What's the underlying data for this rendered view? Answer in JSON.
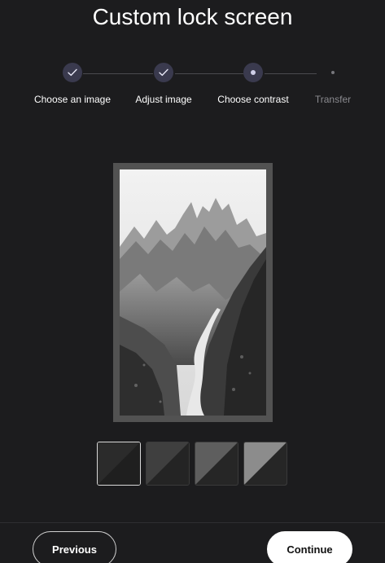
{
  "page": {
    "title": "Custom lock screen"
  },
  "stepper": {
    "steps": [
      {
        "label": "Choose an image",
        "state": "complete"
      },
      {
        "label": "Adjust image",
        "state": "complete"
      },
      {
        "label": "Choose contrast",
        "state": "current"
      },
      {
        "label": "Transfer",
        "state": "upcoming"
      }
    ]
  },
  "preview": {
    "image_description_icon": "mountain-landscape-image"
  },
  "contrast": {
    "options": [
      {
        "id": "contrast-1",
        "selected": true
      },
      {
        "id": "contrast-2",
        "selected": false
      },
      {
        "id": "contrast-3",
        "selected": false
      },
      {
        "id": "contrast-4",
        "selected": false
      }
    ]
  },
  "footer": {
    "previous_label": "Previous",
    "continue_label": "Continue"
  },
  "colors": {
    "background": "#1c1c1e",
    "step_circle": "#3a3a4e",
    "accent_light": "#ffffff"
  }
}
